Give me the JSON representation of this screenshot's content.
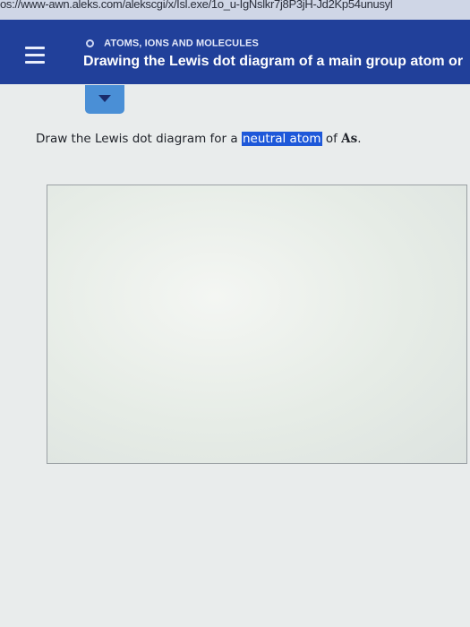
{
  "browser": {
    "url": "os://www-awn.aleks.com/alekscgi/x/Isl.exe/1o_u-IgNslkr7j8P3jH-Jd2Kp54unusyl"
  },
  "header": {
    "topic": "ATOMS, IONS AND MOLECULES",
    "lesson_title": "Drawing the Lewis dot diagram of a main group atom or"
  },
  "question": {
    "prefix": "Draw the Lewis dot diagram for a ",
    "highlighted": "neutral atom",
    "middle": " of ",
    "element": "As",
    "suffix": "."
  },
  "colors": {
    "header_bg": "#21409a",
    "highlight_bg": "#1e58d9",
    "dropdown_bg": "#4a8fd6"
  }
}
